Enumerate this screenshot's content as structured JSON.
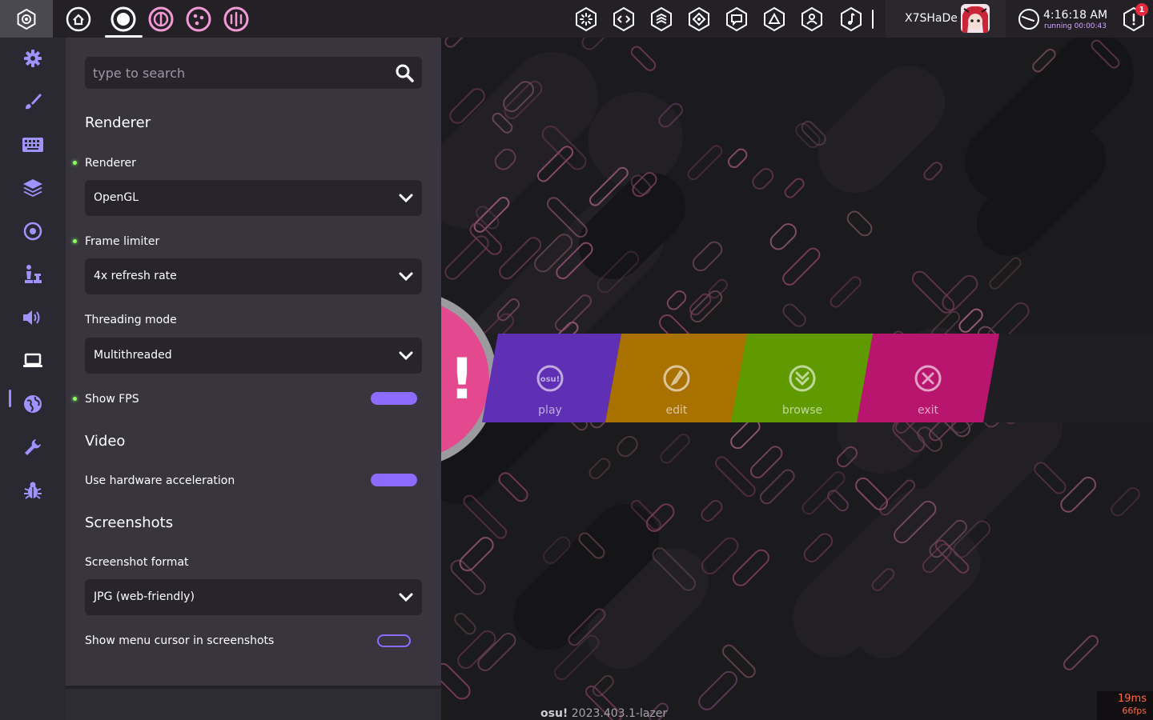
{
  "topbar": {
    "settings_icon": "gear-icon",
    "ruleset_icons": [
      "home-icon",
      "osu-ruleset-icon",
      "taiko-ruleset-icon",
      "catch-ruleset-icon",
      "mania-ruleset-icon"
    ],
    "toolbar_icons": [
      "beatmap-listing-icon",
      "chat-icon",
      "news-icon",
      "rankings-icon",
      "changelog-icon",
      "dashboard-icon",
      "wiki-icon",
      "music-icon"
    ],
    "username": "X7SHaDe",
    "clock": "4:16:18 AM",
    "running": "running 00:00:43",
    "notification_count": "1"
  },
  "sidebar": {
    "items": [
      {
        "name": "general",
        "icon": "gear-icon"
      },
      {
        "name": "skin",
        "icon": "brush-icon"
      },
      {
        "name": "input",
        "icon": "keyboard-icon"
      },
      {
        "name": "user-interface",
        "icon": "layers-icon"
      },
      {
        "name": "gameplay",
        "icon": "circle-target-icon"
      },
      {
        "name": "rulesets",
        "icon": "chess-icon"
      },
      {
        "name": "audio",
        "icon": "speaker-icon"
      },
      {
        "name": "graphics",
        "icon": "laptop-icon"
      },
      {
        "name": "online",
        "icon": "globe-icon"
      },
      {
        "name": "maintenance",
        "icon": "wrench-icon"
      },
      {
        "name": "debug",
        "icon": "bug-icon"
      }
    ],
    "active": "graphics"
  },
  "search": {
    "placeholder": "type to search"
  },
  "panel": {
    "renderer_section": "Renderer",
    "renderer_label": "Renderer",
    "renderer_value": "OpenGL",
    "frame_limiter_label": "Frame limiter",
    "frame_limiter_value": "4x refresh rate",
    "threading_label": "Threading mode",
    "threading_value": "Multithreaded",
    "show_fps_label": "Show FPS",
    "show_fps_on": true,
    "video_section": "Video",
    "hw_accel_label": "Use hardware acceleration",
    "hw_accel_on": true,
    "screenshots_section": "Screenshots",
    "screenshot_format_label": "Screenshot format",
    "screenshot_format_value": "JPG (web-friendly)",
    "menu_cursor_label": "Show menu cursor in screenshots",
    "menu_cursor_on": false
  },
  "menu": {
    "buttons": [
      {
        "label": "play",
        "color": "#5f2fb4",
        "icon": "osu-logo-icon",
        "icon_text": "osu!"
      },
      {
        "label": "edit",
        "color": "#a97200",
        "icon": "pencil-circle-icon"
      },
      {
        "label": "browse",
        "color": "#5f9a00",
        "icon": "chevrons-down-icon"
      },
      {
        "label": "exit",
        "color": "#b8156f",
        "icon": "close-circle-icon"
      }
    ],
    "logo_color": "#e4488e"
  },
  "footer": {
    "version_brand": "osu!",
    "version": "2023.403.1-lazer",
    "frame_time": "19ms",
    "fps": "66fps"
  },
  "colors": {
    "accent": "#8d6bff",
    "changed_dot": "#8cff5c"
  }
}
